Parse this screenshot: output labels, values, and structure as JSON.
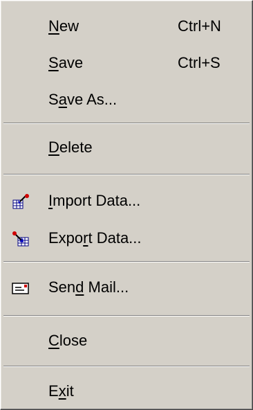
{
  "menu": {
    "items": [
      {
        "pre": "",
        "key": "N",
        "post": "ew",
        "shortcut": "Ctrl+N"
      },
      {
        "pre": "",
        "key": "S",
        "post": "ave",
        "shortcut": "Ctrl+S"
      },
      {
        "pre": "S",
        "key": "a",
        "post": "ve As...",
        "shortcut": ""
      },
      {
        "pre": "",
        "key": "D",
        "post": "elete",
        "shortcut": ""
      },
      {
        "pre": "",
        "key": "I",
        "post": "mport Data...",
        "shortcut": "",
        "icon": "import-data-icon"
      },
      {
        "pre": "Expo",
        "key": "r",
        "post": "t Data...",
        "shortcut": "",
        "icon": "export-data-icon"
      },
      {
        "pre": "Sen",
        "key": "d",
        "post": " Mail...",
        "shortcut": "",
        "icon": "mail-icon"
      },
      {
        "pre": "",
        "key": "C",
        "post": "lose",
        "shortcut": ""
      },
      {
        "pre": "E",
        "key": "x",
        "post": "it",
        "shortcut": ""
      }
    ]
  },
  "colors": {
    "menu_face": "#d4d0c8",
    "shadow": "#808080",
    "highlight": "#ffffff"
  }
}
